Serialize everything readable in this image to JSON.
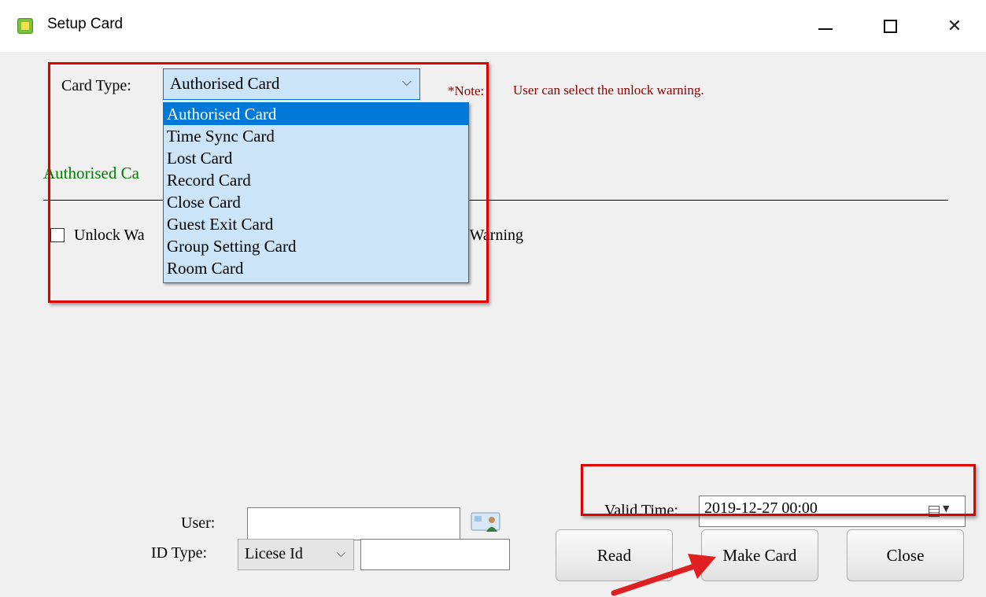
{
  "window": {
    "title": "Setup Card",
    "min_icon": "minimize-icon",
    "max_icon": "maximize-icon",
    "close_glyph": "✕"
  },
  "card_type": {
    "label": "Card Type:",
    "selected": "Authorised Card",
    "options": [
      "Authorised Card",
      "Time Sync Card",
      "Lost Card",
      "Record Card",
      "Close Card",
      "Guest Exit Card",
      "Group Setting Card",
      "Room Card"
    ]
  },
  "note": {
    "prefix": "*Note:",
    "text": "User can select the unlock warning."
  },
  "section": {
    "title": "Authorised Ca",
    "checkbox_label": "Unlock Wa",
    "warning_tail": "p Warning"
  },
  "user": {
    "label": "User:",
    "value": ""
  },
  "id_type": {
    "label": "ID Type:",
    "selected": "Licese Id",
    "value": ""
  },
  "valid_time": {
    "label": "Valid Time:",
    "value": "2019-12-27 00:00"
  },
  "buttons": {
    "read": "Read",
    "make_card": "Make Card",
    "close": "Close"
  },
  "colors": {
    "highlight": "#e00000",
    "selection": "#0078d7",
    "note": "#8b0000",
    "section": "#008000",
    "arrow": "#e02020"
  }
}
